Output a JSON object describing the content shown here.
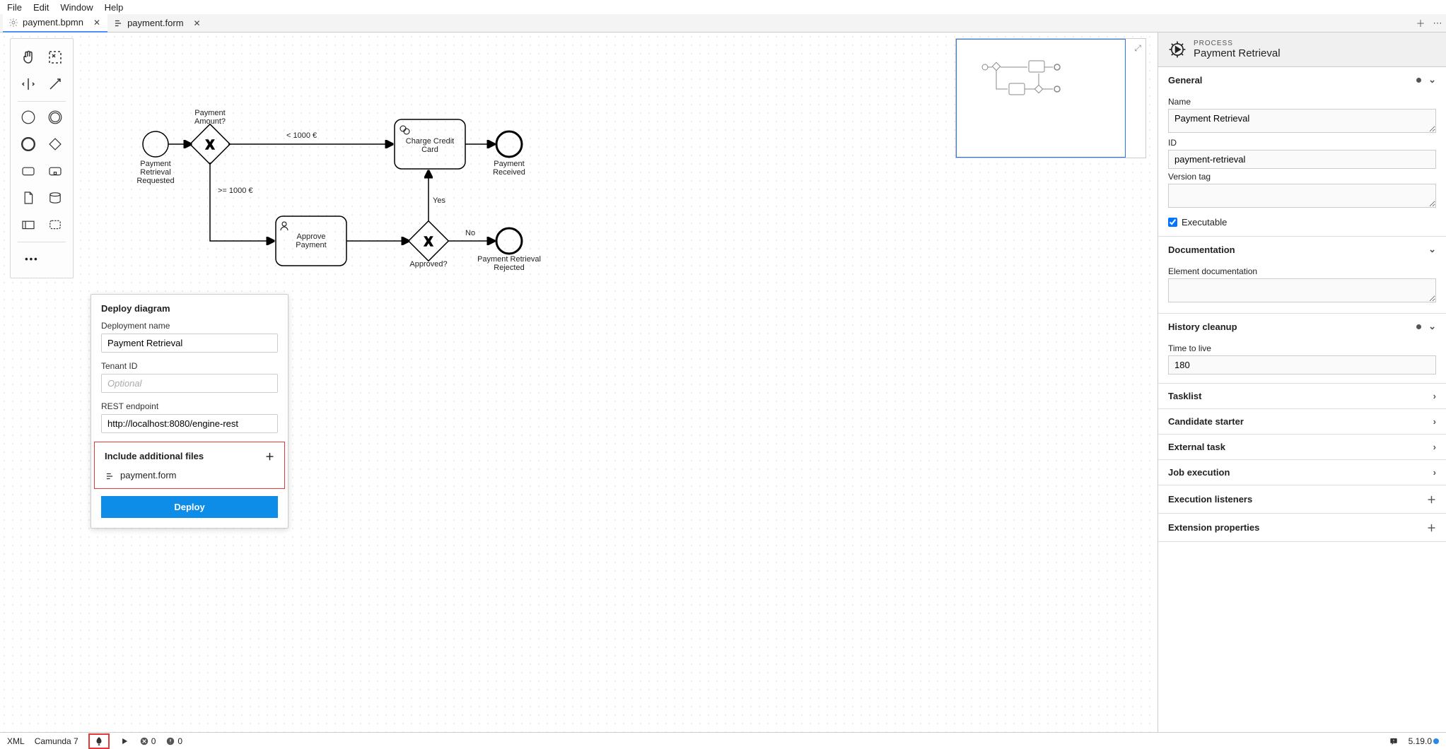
{
  "menubar": [
    "File",
    "Edit",
    "Window",
    "Help"
  ],
  "tabs": [
    {
      "icon": "gear",
      "label": "payment.bpmn",
      "active": true
    },
    {
      "icon": "form",
      "label": "payment.form",
      "active": false
    }
  ],
  "diagram": {
    "start": {
      "label": "Payment Retrieval Requested"
    },
    "gw_amount": {
      "label": "Payment Amount?"
    },
    "edge_lt": "< 1000 €",
    "edge_ge": ">= 1000 €",
    "task_charge": "Charge Credit Card",
    "task_approve": "Approve Payment",
    "gw_approved": {
      "label": "Approved?"
    },
    "edge_yes": "Yes",
    "edge_no": "No",
    "end_received": "Payment Received",
    "end_rejected": "Payment Retrieval Rejected"
  },
  "deploy": {
    "title": "Deploy diagram",
    "name_label": "Deployment name",
    "name_value": "Payment Retrieval",
    "tenant_label": "Tenant ID",
    "tenant_placeholder": "Optional",
    "rest_label": "REST endpoint",
    "rest_value": "http://localhost:8080/engine-rest",
    "files_title": "Include additional files",
    "file": "payment.form",
    "button": "Deploy"
  },
  "props": {
    "sup": "PROCESS",
    "title": "Payment Retrieval",
    "general": {
      "title": "General",
      "name_label": "Name",
      "name": "Payment Retrieval",
      "id_label": "ID",
      "id": "payment-retrieval",
      "version_label": "Version tag",
      "version": "",
      "executable_label": "Executable"
    },
    "documentation": {
      "title": "Documentation",
      "label": "Element documentation"
    },
    "history": {
      "title": "History cleanup",
      "ttl_label": "Time to live",
      "ttl": "180"
    },
    "simple": [
      {
        "label": "Tasklist",
        "chev": true
      },
      {
        "label": "Candidate starter",
        "chev": true
      },
      {
        "label": "External task",
        "chev": true
      },
      {
        "label": "Job execution",
        "chev": true
      },
      {
        "label": "Execution listeners",
        "plus": true
      },
      {
        "label": "Extension properties",
        "plus": true
      }
    ]
  },
  "status": {
    "left": [
      "XML",
      "Camunda 7"
    ],
    "errors": "0",
    "warnings": "0",
    "version": "5.19.0"
  }
}
